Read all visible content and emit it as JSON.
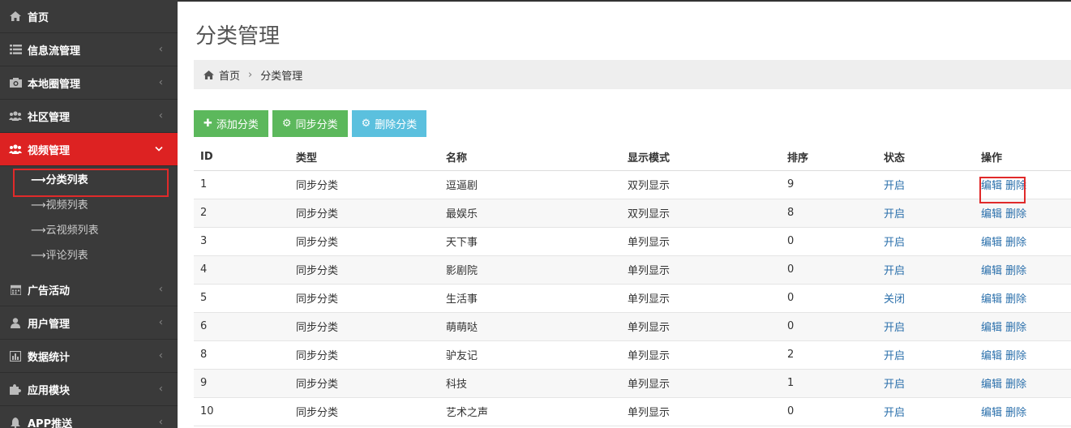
{
  "sidebar": {
    "items": [
      {
        "label": "首页",
        "icon": "home-icon"
      },
      {
        "label": "信息流管理",
        "icon": "list-icon"
      },
      {
        "label": "本地圈管理",
        "icon": "camera-icon"
      },
      {
        "label": "社区管理",
        "icon": "group-icon"
      },
      {
        "label": "视频管理",
        "icon": "group-icon",
        "active": true
      },
      {
        "label": "广告活动",
        "icon": "calendar-icon"
      },
      {
        "label": "用户管理",
        "icon": "user-icon"
      },
      {
        "label": "数据统计",
        "icon": "bar-chart-icon"
      },
      {
        "label": "应用模块",
        "icon": "puzzle-icon"
      },
      {
        "label": "APP推送",
        "icon": "bell-icon"
      }
    ],
    "video_sub": [
      {
        "label": "⟶分类列表"
      },
      {
        "label": "⟶视频列表"
      },
      {
        "label": "⟶云视频列表"
      },
      {
        "label": "⟶评论列表"
      }
    ]
  },
  "main": {
    "title": "分类管理",
    "breadcrumb": {
      "home": "首页",
      "sep": "›",
      "current": "分类管理"
    },
    "buttons": {
      "add": "添加分类",
      "sync": "同步分类",
      "delete": "删除分类"
    },
    "colors": {
      "green": "#5cb85c",
      "blue": "#5bc0de",
      "active": "#dd2222"
    }
  },
  "table": {
    "headers": [
      "ID",
      "类型",
      "名称",
      "显示模式",
      "排序",
      "状态",
      "操作"
    ],
    "edit_label": "编辑",
    "delete_label": "删除",
    "rows": [
      {
        "id": "1",
        "type": "同步分类",
        "name": "逗逼剧",
        "mode": "双列显示",
        "sort": "9",
        "status": "开启"
      },
      {
        "id": "2",
        "type": "同步分类",
        "name": "最娱乐",
        "mode": "双列显示",
        "sort": "8",
        "status": "开启"
      },
      {
        "id": "3",
        "type": "同步分类",
        "name": "天下事",
        "mode": "单列显示",
        "sort": "0",
        "status": "开启"
      },
      {
        "id": "4",
        "type": "同步分类",
        "name": "影剧院",
        "mode": "单列显示",
        "sort": "0",
        "status": "开启"
      },
      {
        "id": "5",
        "type": "同步分类",
        "name": "生活事",
        "mode": "单列显示",
        "sort": "0",
        "status": "关闭"
      },
      {
        "id": "6",
        "type": "同步分类",
        "name": "萌萌哒",
        "mode": "单列显示",
        "sort": "0",
        "status": "开启"
      },
      {
        "id": "8",
        "type": "同步分类",
        "name": "驴友记",
        "mode": "单列显示",
        "sort": "2",
        "status": "开启"
      },
      {
        "id": "9",
        "type": "同步分类",
        "name": "科技",
        "mode": "单列显示",
        "sort": "1",
        "status": "开启"
      },
      {
        "id": "10",
        "type": "同步分类",
        "name": "艺术之声",
        "mode": "单列显示",
        "sort": "0",
        "status": "开启"
      }
    ]
  }
}
